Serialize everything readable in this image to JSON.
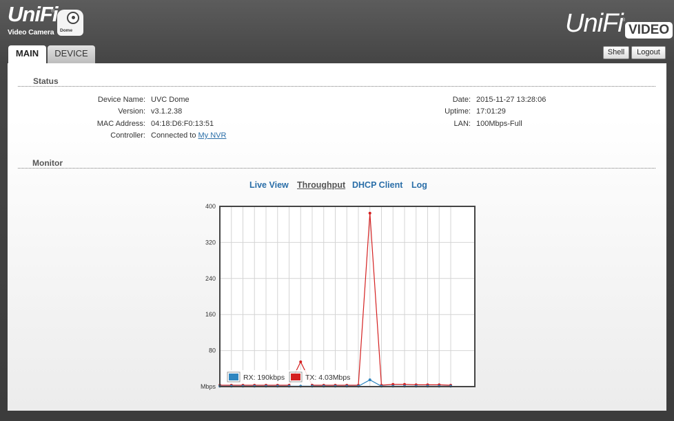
{
  "header": {
    "left_logo": {
      "brand": "UniFi",
      "reg": "®",
      "product": "Video Camera",
      "camera_label": "Dome"
    },
    "right_logo": {
      "brand": "UniFi",
      "reg": "®",
      "badge": "VIDEO"
    },
    "buttons": {
      "shell": "Shell",
      "logout": "Logout"
    }
  },
  "tabs": [
    {
      "label": "MAIN",
      "active": true
    },
    {
      "label": "DEVICE",
      "active": false
    }
  ],
  "status": {
    "title": "Status",
    "left": [
      {
        "key": "Device Name:",
        "value": "UVC Dome"
      },
      {
        "key": "Version:",
        "value": "v3.1.2.38"
      },
      {
        "key": "MAC Address:",
        "value": "04:18:D6:F0:13:51"
      },
      {
        "key": "Controller:",
        "value": "Connected to",
        "link": "My NVR"
      }
    ],
    "right": [
      {
        "key": "Date:",
        "value": "2015-11-27 13:28:06"
      },
      {
        "key": "Uptime:",
        "value": "17:01:29"
      },
      {
        "key": "LAN:",
        "value": "100Mbps-Full"
      }
    ]
  },
  "monitor": {
    "title": "Monitor",
    "links": [
      {
        "label": "Live View",
        "active": false
      },
      {
        "label": "Throughput",
        "active": true
      },
      {
        "label": "DHCP Client",
        "active": false
      },
      {
        "label": "Log",
        "active": false
      }
    ]
  },
  "colors": {
    "rx": "#2f86c0",
    "tx": "#d42020",
    "link": "#2a6ea8"
  },
  "chart_data": {
    "type": "line",
    "ylabel": "Mbps",
    "ylim": [
      0,
      400
    ],
    "yticks": [
      80,
      160,
      240,
      320,
      400
    ],
    "grid": true,
    "legend": "bottom-left",
    "x_count": 21,
    "series": [
      {
        "name": "RX",
        "legend_label": "RX: 190kbps",
        "color": "#2f86c0",
        "values": [
          1,
          1,
          1,
          1,
          1,
          1,
          1,
          1,
          1,
          1,
          1,
          1,
          1,
          15,
          1,
          1,
          1,
          1,
          1,
          1,
          1
        ]
      },
      {
        "name": "TX",
        "legend_label": "TX: 4.03Mbps",
        "color": "#d42020",
        "values": [
          3,
          3,
          3,
          3,
          3,
          3,
          3,
          55,
          3,
          3,
          3,
          3,
          3,
          385,
          3,
          5,
          5,
          4,
          4,
          4,
          3
        ]
      }
    ]
  }
}
